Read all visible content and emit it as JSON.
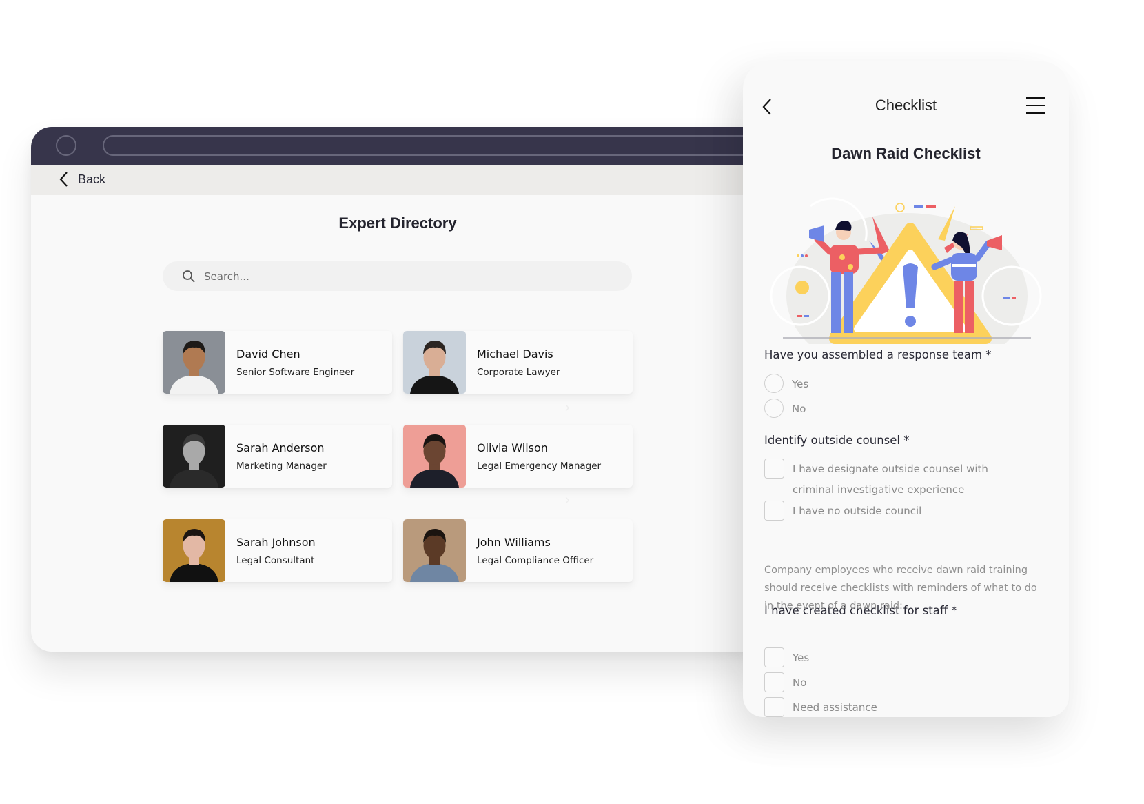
{
  "desktop": {
    "nav": {
      "back_label": "Back"
    },
    "page_title": "Expert Directory",
    "search": {
      "placeholder": "Search...",
      "value": ""
    },
    "experts": [
      {
        "name": "David Chen",
        "role": "Senior Software Engineer",
        "photo_bg": "#8a8f96",
        "skin": "#b07a52",
        "hair": "#1d1a18",
        "shirt": "#f2f2f2"
      },
      {
        "name": "Michael Davis",
        "role": "Corporate Lawyer",
        "photo_bg": "#c9d2db",
        "skin": "#d9ae95",
        "hair": "#2b2522",
        "shirt": "#151515"
      },
      {
        "name": "Sarah Anderson",
        "role": "Marketing Manager",
        "photo_bg": "#1f1f1f",
        "skin": "#a9a9a9",
        "hair": "#3a3a3a",
        "shirt": "#2a2a2a"
      },
      {
        "name": "Olivia Wilson",
        "role": "Legal Emergency Manager",
        "photo_bg": "#ee9e96",
        "skin": "#6b4532",
        "hair": "#1a1412",
        "shirt": "#1d1f2a"
      },
      {
        "name": "Sarah Johnson",
        "role": "Legal Consultant",
        "photo_bg": "#b8852f",
        "skin": "#e3b8a5",
        "hair": "#1b1512",
        "shirt": "#111111"
      },
      {
        "name": "John Williams",
        "role": "Legal Compliance Officer",
        "photo_bg": "#b99a7c",
        "skin": "#5b3a26",
        "hair": "#1a1410",
        "shirt": "#6f86a3"
      }
    ]
  },
  "checklist": {
    "header_title": "Checklist",
    "heading": "Dawn Raid Checklist",
    "questions": [
      {
        "label": "Have you assembled a response team *",
        "type": "radio",
        "options": [
          "Yes",
          "No"
        ]
      },
      {
        "label": "Identify outside counsel *",
        "type": "checkbox",
        "options": [
          "I have designate outside counsel with criminal investigative experience",
          "I have no outside council"
        ]
      },
      {
        "label": "I have created checklist for staff *",
        "type": "checkbox",
        "options": [
          "Yes",
          "No",
          "Need assistance"
        ]
      }
    ],
    "note": "Company employees who receive dawn raid training should receive checklists with reminders of what to do in the event of a dawn raid:"
  },
  "colors": {
    "titlebar": "#37354b",
    "navbar": "#edecea",
    "illustration_yellow": "#fcd15b",
    "illustration_red": "#ec5f64",
    "illustration_blue": "#6e86e6"
  }
}
